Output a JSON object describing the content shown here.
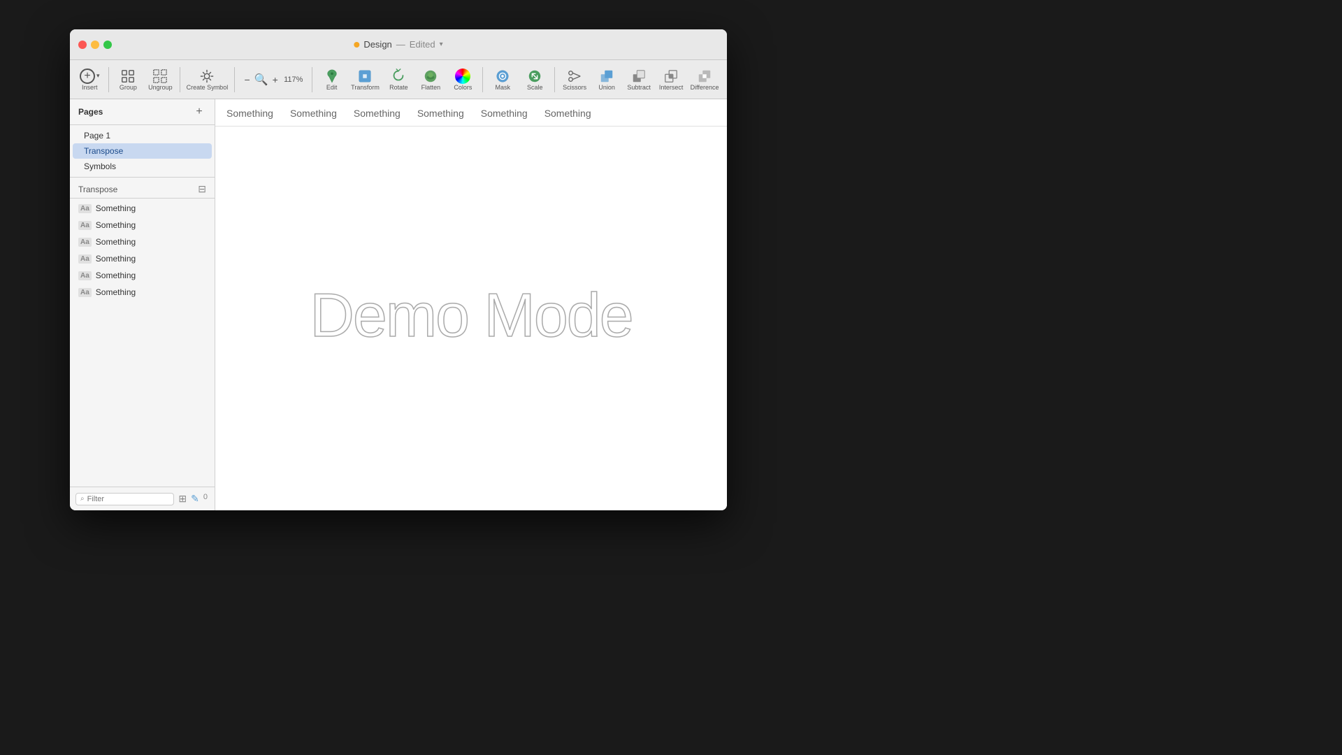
{
  "app": {
    "title": "Design",
    "title_suffix": "Edited",
    "bg_color": "#1a1a1a"
  },
  "titlebar": {
    "title": "Design",
    "subtitle": "Edited"
  },
  "toolbar": {
    "insert_label": "Insert",
    "group_label": "Group",
    "ungroup_label": "Ungroup",
    "create_symbol_label": "Create Symbol",
    "zoom_level": "117%",
    "edit_label": "Edit",
    "transform_label": "Transform",
    "rotate_label": "Rotate",
    "flatten_label": "Flatten",
    "colors_label": "Colors",
    "mask_label": "Mask",
    "scale_label": "Scale",
    "scissors_label": "Scissors",
    "union_label": "Union",
    "subtract_label": "Subtract",
    "intersect_label": "Intersect",
    "difference_label": "Difference"
  },
  "sidebar": {
    "pages_title": "Pages",
    "pages": [
      {
        "label": "Page 1",
        "active": false
      },
      {
        "label": "Transpose",
        "active": true
      },
      {
        "label": "Symbols",
        "active": false
      }
    ],
    "layers_section_title": "Transpose",
    "layers": [
      {
        "label": "Something"
      },
      {
        "label": "Something"
      },
      {
        "label": "Something"
      },
      {
        "label": "Something"
      },
      {
        "label": "Something"
      },
      {
        "label": "Something"
      }
    ],
    "filter_placeholder": "Filter"
  },
  "canvas": {
    "tabs": [
      "Something",
      "Something",
      "Something",
      "Something",
      "Something",
      "Something"
    ],
    "demo_mode_text": "Demo Mode"
  }
}
